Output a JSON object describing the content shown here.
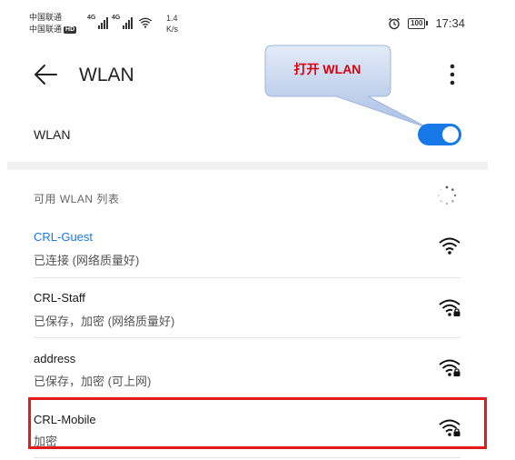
{
  "status_bar": {
    "carrier_1": "中国联通",
    "carrier_2": "中国联通",
    "hd_badge": "HD",
    "network_1": "4G",
    "network_2": "4G",
    "speed_value": "1.4",
    "speed_unit": "K/s",
    "battery_level": "100",
    "time": "17:34",
    "icons": [
      "signal-icon",
      "signal-icon",
      "wifi-icon",
      "alarm-icon",
      "battery-icon"
    ]
  },
  "header": {
    "title": "WLAN",
    "back_icon": "arrow-left-icon",
    "more_icon": "more-vertical-icon"
  },
  "callout": {
    "text": "打开 WLAN",
    "colors": {
      "fill_top": "#e3ebf8",
      "fill_bottom": "#a9bfe3",
      "text": "#d8000c"
    }
  },
  "wlan_toggle": {
    "label": "WLAN",
    "state": "on",
    "color": "#1778e8"
  },
  "list_header": "可用 WLAN 列表",
  "networks": [
    {
      "name": "CRL-Guest",
      "status": "已连接 (网络质量好)",
      "connected": true,
      "locked": false
    },
    {
      "name": "CRL-Staff",
      "status": "已保存，加密 (网络质量好)",
      "connected": false,
      "locked": true
    },
    {
      "name": "address",
      "status": "已保存，加密 (可上网)",
      "connected": false,
      "locked": true
    },
    {
      "name": "CRL-Mobile",
      "status": "加密",
      "connected": false,
      "locked": true,
      "highlighted": true
    }
  ],
  "highlight_color": "#e41919"
}
